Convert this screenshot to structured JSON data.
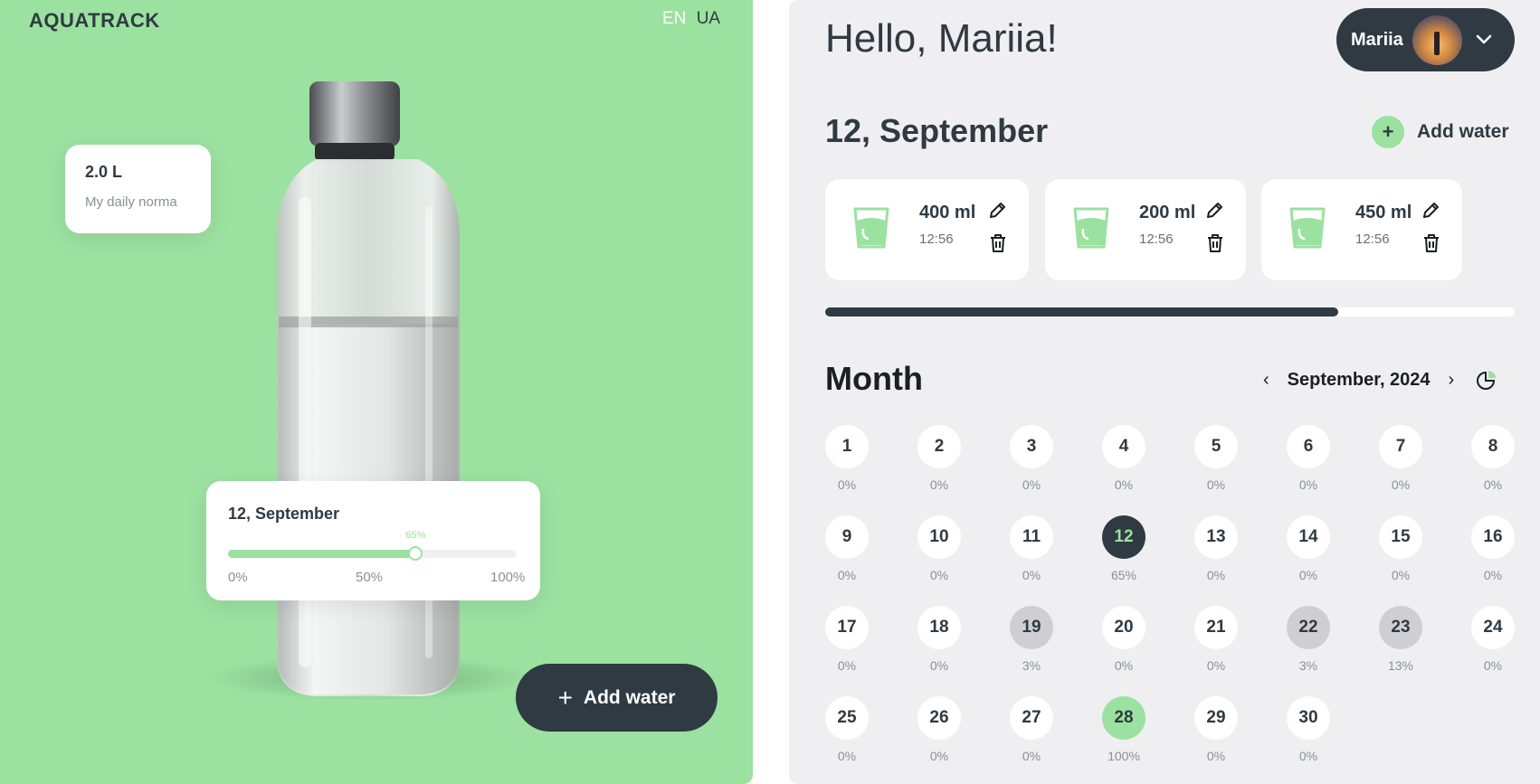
{
  "left": {
    "logo": "AQUATRACK",
    "lang_en": "EN",
    "lang_ua": "UA",
    "norma_value": "2.0 L",
    "norma_label": "My daily norma",
    "progress": {
      "date": "12, September",
      "percent_label": "65%",
      "fraction": 0.65,
      "scale": [
        "0%",
        "50%",
        "100%"
      ]
    },
    "add_water_label": "Add water"
  },
  "right": {
    "greeting": "Hello, Mariia!",
    "user_name": "Mariia",
    "day_title": "12, September",
    "add_water_label": "Add water",
    "entries": [
      {
        "amount": "400 ml",
        "time": "12:56"
      },
      {
        "amount": "200 ml",
        "time": "12:56"
      },
      {
        "amount": "450 ml",
        "time": "12:56"
      }
    ],
    "day_progress_fraction": 0.744,
    "month_title": "Month",
    "month_label": "September, 2024",
    "days": [
      {
        "n": "1",
        "pct": "0%",
        "state": ""
      },
      {
        "n": "2",
        "pct": "0%",
        "state": ""
      },
      {
        "n": "3",
        "pct": "0%",
        "state": ""
      },
      {
        "n": "4",
        "pct": "0%",
        "state": ""
      },
      {
        "n": "5",
        "pct": "0%",
        "state": ""
      },
      {
        "n": "6",
        "pct": "0%",
        "state": ""
      },
      {
        "n": "7",
        "pct": "0%",
        "state": ""
      },
      {
        "n": "8",
        "pct": "0%",
        "state": ""
      },
      {
        "n": "9",
        "pct": "0%",
        "state": ""
      },
      {
        "n": "10",
        "pct": "0%",
        "state": ""
      },
      {
        "n": "11",
        "pct": "0%",
        "state": ""
      },
      {
        "n": "12",
        "pct": "65%",
        "state": "today"
      },
      {
        "n": "13",
        "pct": "0%",
        "state": ""
      },
      {
        "n": "14",
        "pct": "0%",
        "state": ""
      },
      {
        "n": "15",
        "pct": "0%",
        "state": ""
      },
      {
        "n": "16",
        "pct": "0%",
        "state": ""
      },
      {
        "n": "17",
        "pct": "0%",
        "state": ""
      },
      {
        "n": "18",
        "pct": "0%",
        "state": ""
      },
      {
        "n": "19",
        "pct": "3%",
        "state": "partial"
      },
      {
        "n": "20",
        "pct": "0%",
        "state": ""
      },
      {
        "n": "21",
        "pct": "0%",
        "state": ""
      },
      {
        "n": "22",
        "pct": "3%",
        "state": "partial"
      },
      {
        "n": "23",
        "pct": "13%",
        "state": "partial"
      },
      {
        "n": "24",
        "pct": "0%",
        "state": ""
      },
      {
        "n": "25",
        "pct": "0%",
        "state": ""
      },
      {
        "n": "26",
        "pct": "0%",
        "state": ""
      },
      {
        "n": "27",
        "pct": "0%",
        "state": ""
      },
      {
        "n": "28",
        "pct": "100%",
        "state": "full"
      },
      {
        "n": "29",
        "pct": "0%",
        "state": ""
      },
      {
        "n": "30",
        "pct": "0%",
        "state": ""
      }
    ]
  },
  "colors": {
    "accent_green": "#9be1a0",
    "dark": "#2f3a42",
    "panel_gray": "#efeff2"
  }
}
